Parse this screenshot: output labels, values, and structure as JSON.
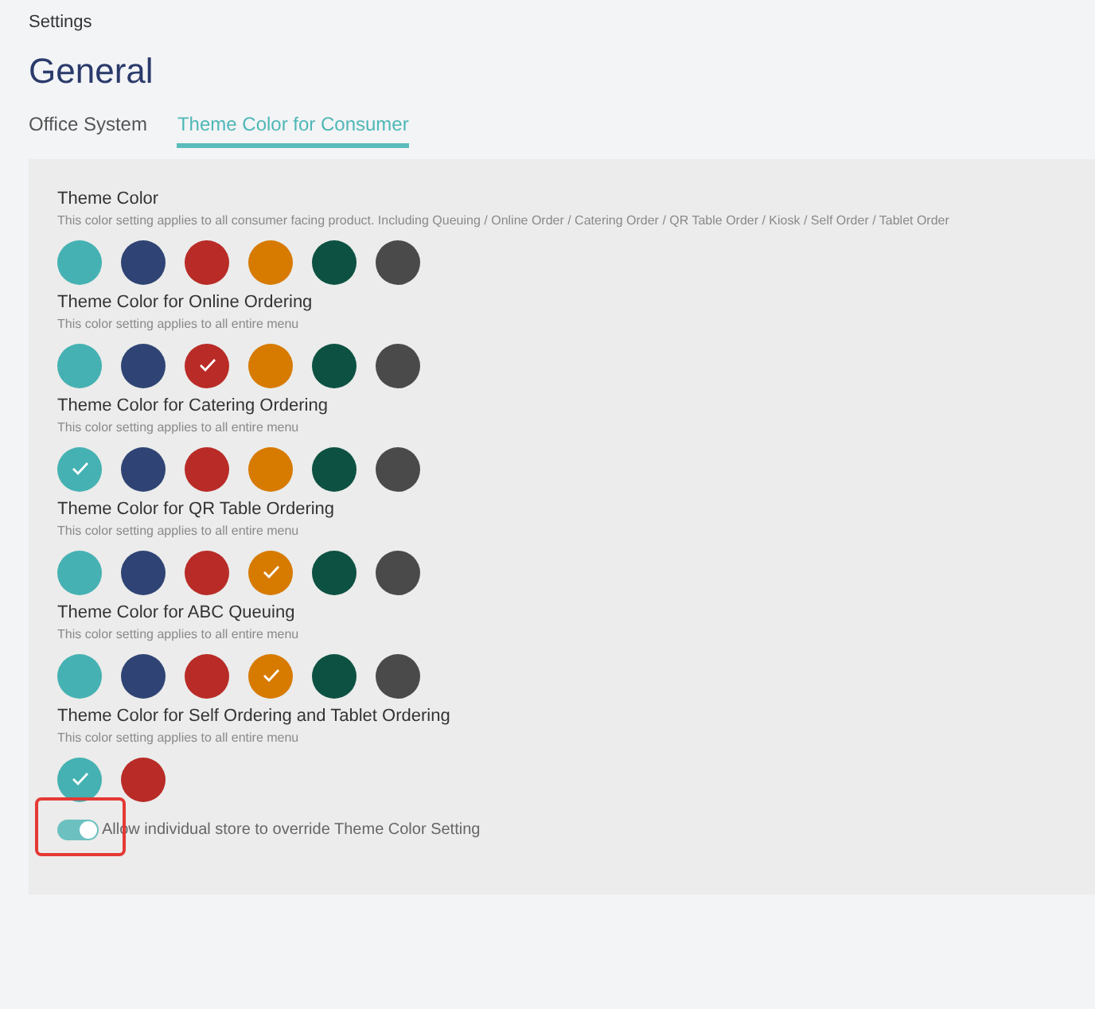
{
  "breadcrumb": "Settings",
  "title": "General",
  "tabs": [
    {
      "label": "Office System",
      "selected": false
    },
    {
      "label": "Theme Color for Consumer",
      "selected": true
    }
  ],
  "sections": [
    {
      "title": "Theme Color",
      "description": "This color setting applies to all consumer facing product. Including Queuing / Online Order / Catering Order / QR Table Order / Kiosk / Self Order / Tablet Order",
      "swatches": [
        {
          "color": "#45b1b3",
          "selected": false
        },
        {
          "color": "#2f4474",
          "selected": false
        },
        {
          "color": "#b92b27",
          "selected": false
        },
        {
          "color": "#d77a00",
          "selected": false
        },
        {
          "color": "#0d5142",
          "selected": false
        },
        {
          "color": "#4a4a4a",
          "selected": false
        }
      ]
    },
    {
      "title": "Theme Color for Online Ordering",
      "description": "This color setting applies to all entire menu",
      "swatches": [
        {
          "color": "#45b1b3",
          "selected": false
        },
        {
          "color": "#2f4474",
          "selected": false
        },
        {
          "color": "#b92b27",
          "selected": true
        },
        {
          "color": "#d77a00",
          "selected": false
        },
        {
          "color": "#0d5142",
          "selected": false
        },
        {
          "color": "#4a4a4a",
          "selected": false
        }
      ]
    },
    {
      "title": "Theme Color for Catering Ordering",
      "description": "This color setting applies to all entire menu",
      "swatches": [
        {
          "color": "#45b1b3",
          "selected": true
        },
        {
          "color": "#2f4474",
          "selected": false
        },
        {
          "color": "#b92b27",
          "selected": false
        },
        {
          "color": "#d77a00",
          "selected": false
        },
        {
          "color": "#0d5142",
          "selected": false
        },
        {
          "color": "#4a4a4a",
          "selected": false
        }
      ]
    },
    {
      "title": "Theme Color for QR Table Ordering",
      "description": "This color setting applies to all entire menu",
      "swatches": [
        {
          "color": "#45b1b3",
          "selected": false
        },
        {
          "color": "#2f4474",
          "selected": false
        },
        {
          "color": "#b92b27",
          "selected": false
        },
        {
          "color": "#d77a00",
          "selected": true
        },
        {
          "color": "#0d5142",
          "selected": false
        },
        {
          "color": "#4a4a4a",
          "selected": false
        }
      ]
    },
    {
      "title": "Theme Color for ABC Queuing",
      "description": "This color setting applies to all entire menu",
      "swatches": [
        {
          "color": "#45b1b3",
          "selected": false
        },
        {
          "color": "#2f4474",
          "selected": false
        },
        {
          "color": "#b92b27",
          "selected": false
        },
        {
          "color": "#d77a00",
          "selected": true
        },
        {
          "color": "#0d5142",
          "selected": false
        },
        {
          "color": "#4a4a4a",
          "selected": false
        }
      ]
    },
    {
      "title": "Theme Color for Self Ordering and Tablet Ordering",
      "description": "This color setting applies to all entire menu",
      "swatches": [
        {
          "color": "#45b1b3",
          "selected": true
        },
        {
          "color": "#b92b27",
          "selected": false
        }
      ]
    }
  ],
  "override_toggle": {
    "label": "Allow individual store to override Theme Color Setting",
    "on": true,
    "highlighted": true
  }
}
